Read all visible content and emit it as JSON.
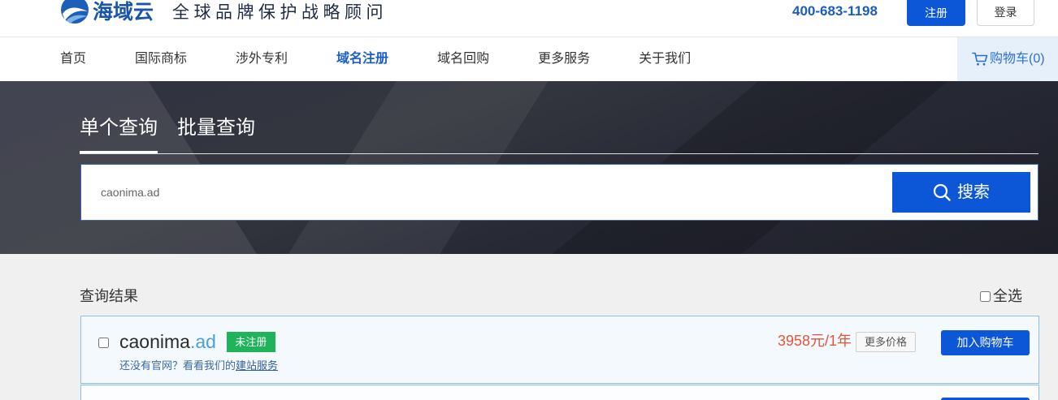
{
  "header": {
    "logo_text": "海域云",
    "slogan": "全球品牌保护战略顾问",
    "phone": "400-683-1198",
    "register_label": "注册",
    "login_label": "登录"
  },
  "nav": {
    "items": [
      {
        "label": "首页",
        "active": false
      },
      {
        "label": "国际商标",
        "active": false
      },
      {
        "label": "涉外专利",
        "active": false
      },
      {
        "label": "域名注册",
        "active": true
      },
      {
        "label": "域名回购",
        "active": false
      },
      {
        "label": "更多服务",
        "active": false
      },
      {
        "label": "关于我们",
        "active": false
      }
    ],
    "cart_label": "购物车(0)"
  },
  "search": {
    "tabs": [
      {
        "label": "单个查询",
        "active": true
      },
      {
        "label": "批量查询",
        "active": false
      }
    ],
    "query_value": "caonima.ad",
    "button_label": "搜索"
  },
  "results": {
    "title": "查询结果",
    "select_all_label": "全选",
    "select_all_checked": false,
    "items": [
      {
        "selected": false,
        "domain_name": "caonima",
        "tld": ".ad",
        "status": "未注册",
        "hint_prefix": "还没有官网？看看我们的",
        "hint_link": "建站服务",
        "price": "3958元/1年",
        "more_prices_label": "更多价格",
        "add_to_cart_label": "加入购物车"
      }
    ]
  },
  "icons": {
    "logo": "logo-icon",
    "cart": "cart-icon",
    "search": "search-icon"
  },
  "colors": {
    "primary": "#0c57d8",
    "price": "#e2553a",
    "badge": "#1fb35a",
    "tld": "#4aa0d8",
    "hint": "#3a6aa3",
    "card-border": "#8dbfe5"
  }
}
